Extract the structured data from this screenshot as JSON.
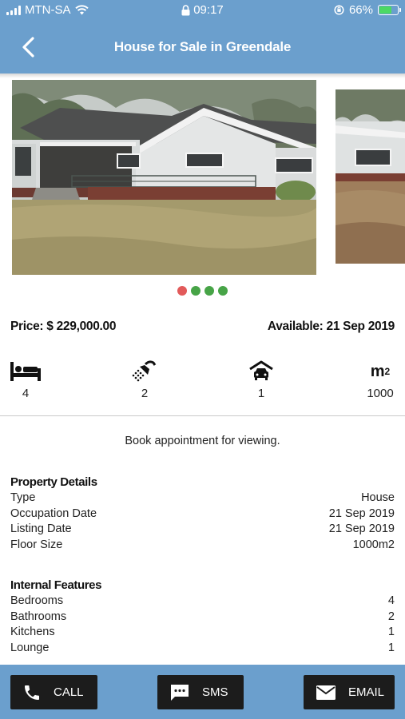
{
  "status_bar": {
    "carrier": "MTN-SA",
    "time": "09:17",
    "battery": "66%",
    "battery_level": 0.66,
    "icons": [
      "signal-icon",
      "wifi-icon",
      "lock-icon",
      "rotation-lock-icon",
      "battery-charging-icon"
    ]
  },
  "header": {
    "title": "House for Sale in Greendale",
    "back_icon": "chevron-left-icon"
  },
  "gallery": {
    "image_count": 4,
    "active_index": 0,
    "dot_colors": {
      "active": "#e25a5a",
      "inactive": "#47a447"
    }
  },
  "listing": {
    "price": "Price: $ 229,000.00",
    "available": "Available: 21 Sep 2019"
  },
  "features": {
    "bedrooms": "4",
    "bathrooms": "2",
    "garages": "1",
    "area_unit": "m",
    "area_unit_power": "2",
    "area": "1000",
    "icons": [
      "bed-icon",
      "shower-icon",
      "car-garage-icon",
      "area-m2-icon"
    ]
  },
  "booking_note": "Book appointment for viewing.",
  "property_details": {
    "title": "Property Details",
    "rows": [
      {
        "label": "Type",
        "value": "House"
      },
      {
        "label": "Occupation Date",
        "value": "21 Sep 2019"
      },
      {
        "label": "Listing Date",
        "value": "21 Sep 2019"
      },
      {
        "label": "Floor Size",
        "value": "1000m2"
      }
    ]
  },
  "internal_features": {
    "title": "Internal Features",
    "rows": [
      {
        "label": "Bedrooms",
        "value": "4"
      },
      {
        "label": "Bathrooms",
        "value": "2"
      },
      {
        "label": "Kitchens",
        "value": "1"
      },
      {
        "label": "Lounge",
        "value": "1"
      }
    ]
  },
  "actions": {
    "call": "CALL",
    "sms": "SMS",
    "email": "EMAIL"
  },
  "colors": {
    "brand_blue": "#6b9fcd",
    "button_dark": "#1c1c1c"
  }
}
